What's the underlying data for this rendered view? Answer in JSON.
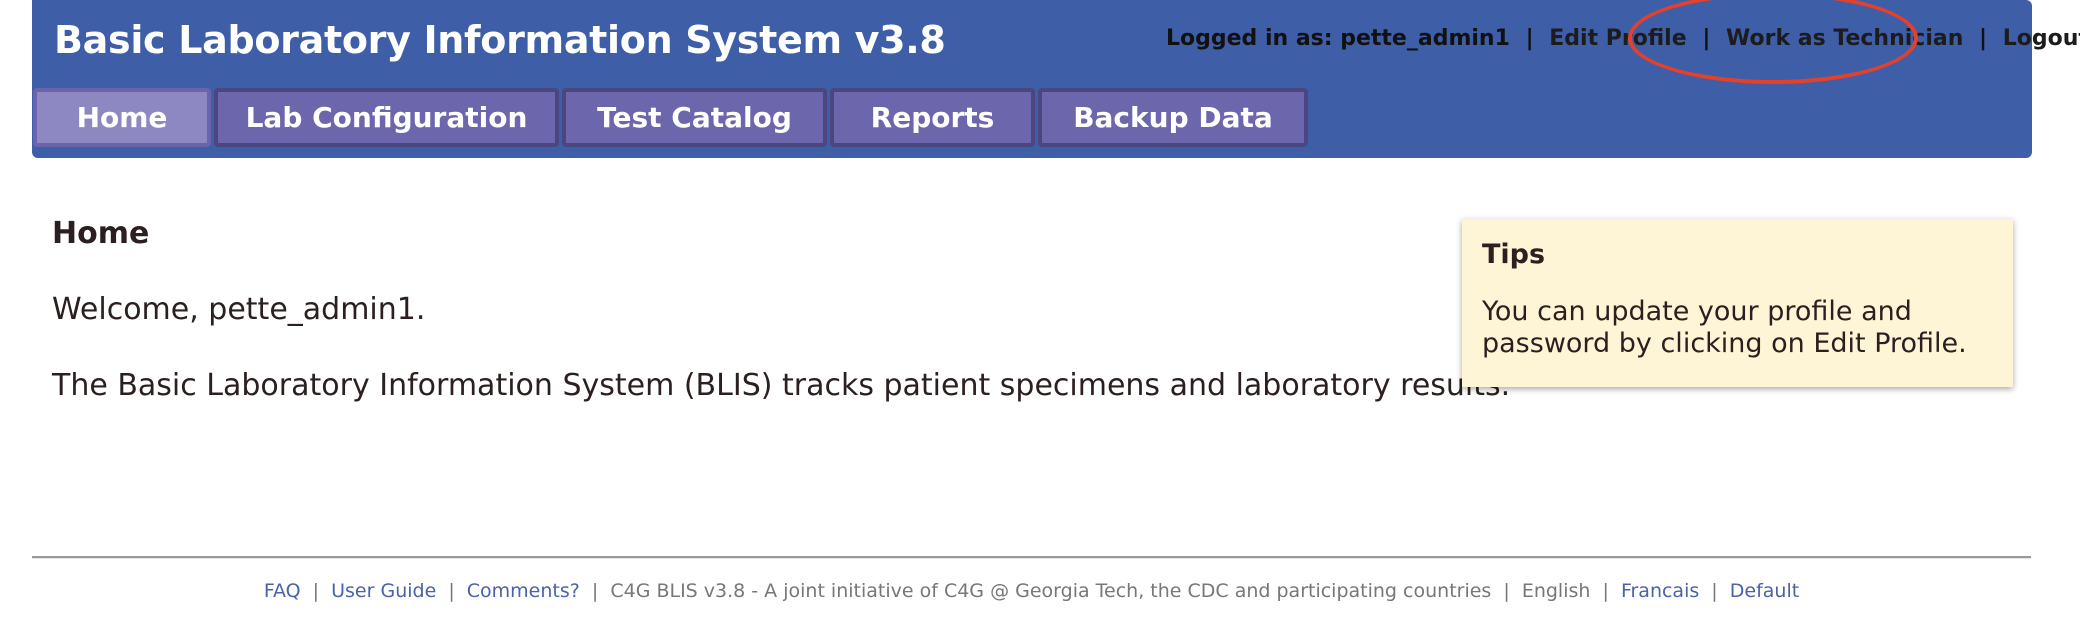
{
  "header": {
    "app_title": "Basic Laboratory Information System v3.8",
    "userbar": {
      "logged_in_prefix": "Logged in as:",
      "username": "pette_admin1",
      "separator": "|",
      "edit_profile": "Edit Profile",
      "work_as_technician": "Work as Technician",
      "logout": "Logout"
    },
    "tabs": [
      {
        "label": "Home",
        "active": true
      },
      {
        "label": "Lab Configuration",
        "active": false
      },
      {
        "label": "Test Catalog",
        "active": false
      },
      {
        "label": "Reports",
        "active": false
      },
      {
        "label": "Backup Data",
        "active": false
      }
    ]
  },
  "annotation": {
    "type": "red-ellipse",
    "target": "Work as Technician",
    "color": "#e5412a"
  },
  "main": {
    "heading": "Home",
    "welcome": "Welcome, pette_admin1.",
    "description": "The Basic Laboratory Information System (BLIS) tracks patient specimens and laboratory results."
  },
  "tips": {
    "title": "Tips",
    "body": "You can update your profile and password by clicking on Edit Profile."
  },
  "footer": {
    "faq": "FAQ",
    "user_guide": "User Guide",
    "comments": "Comments?",
    "credit": "C4G BLIS v3.8 - A joint initiative of C4G @ Georgia Tech, the CDC and participating countries",
    "english": "English",
    "francais": "Francais",
    "default": "Default",
    "separator": "|"
  },
  "colors": {
    "header_bg": "#3f5ea8",
    "tab_bg": "#6c66ac",
    "tab_active_bg": "#8e88c2",
    "tips_bg": "#fdf5d5",
    "link": "#4a63a8"
  }
}
